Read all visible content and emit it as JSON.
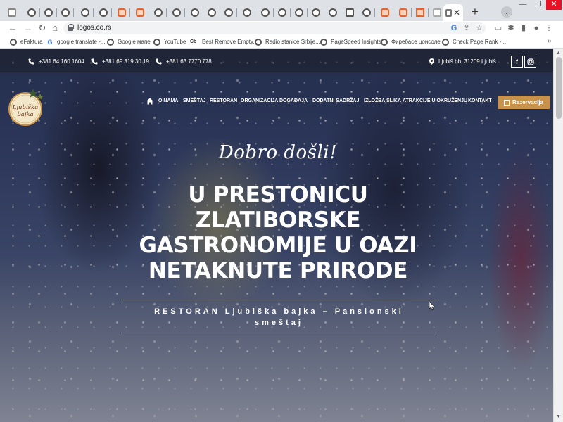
{
  "browser": {
    "url": "logos.co.rs",
    "bookmarks": [
      {
        "label": "eFaktura",
        "icon": "globe-icon"
      },
      {
        "label": "google translate -...",
        "icon": "google-icon"
      },
      {
        "label": "Google мапе",
        "icon": "globe-icon"
      },
      {
        "label": "YouTube",
        "icon": "globe-icon"
      },
      {
        "label": "Best Remove Empty...",
        "icon": "cb-icon"
      },
      {
        "label": "Radio stanice Srbije...",
        "icon": "globe-icon"
      },
      {
        "label": "PageSpeed Insights",
        "icon": "globe-icon"
      },
      {
        "label": "Фиребасе цонсоле",
        "icon": "globe-icon"
      },
      {
        "label": "Check Page Rank -...",
        "icon": "globe-icon"
      }
    ],
    "bookmarks_more": "»"
  },
  "site": {
    "phones": [
      "+381 64 160 1604",
      "+381 69 319 30 19",
      "+381 63 7770 778"
    ],
    "address": "Ljubiš bb, 31209 Ljubiš",
    "logo_text_1": "Ljubiška",
    "logo_text_2": "bajka",
    "nav": [
      "O NAMA",
      "SMEŠTAJ",
      "RESTORAN",
      "ORGANIZACIJA DOGAĐAJA",
      "DODATNI SADRŽAJ",
      "IZLOŽBA SLIKA",
      "ATRAKCIJE U OKRUŽENJU",
      "KONTAKT"
    ],
    "reserve_label": "Rezervacija",
    "welcome": "Dobro došli!",
    "headline": [
      "U PRESTONICU",
      "ZLATIBORSKE",
      "GASTRONOMIJE U OAZI",
      "NETAKNUTE PRIRODE"
    ],
    "subtitle_1": "RESTORAN Ljubiška bajka – Pansionski",
    "subtitle_2": "smeštaj"
  },
  "colors": {
    "accent": "#c8924a",
    "overlay": "#1e2028",
    "chrome_tabstrip": "#dee1e6"
  }
}
